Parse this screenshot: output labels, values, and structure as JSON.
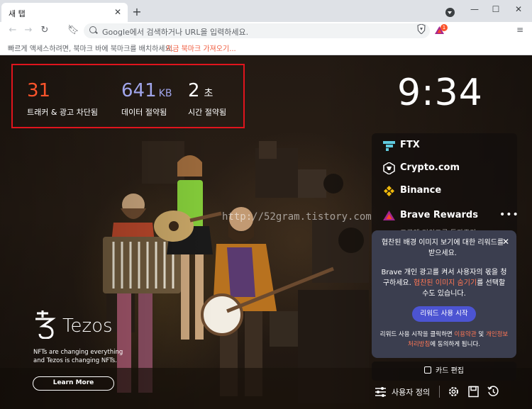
{
  "browser": {
    "tab_title": "새 탭",
    "omnibox_placeholder": "Google에서 검색하거나 URL을 입력하세요.",
    "rewards_badge": "1",
    "bookmark_bar_text": "빠르게 액세스하려면, 북마크 바에 북마크를 배치하세요.",
    "bookmark_bar_link": "지금 북마크 가져오기..."
  },
  "stats": {
    "trackers": {
      "value": "31",
      "label": "트래커 & 광고 차단됨",
      "color": "#fb542b"
    },
    "data": {
      "value": "641",
      "unit": "KB",
      "label": "데이터 절약됨",
      "color": "#a0a5eb"
    },
    "time": {
      "value": "2",
      "unit": "초",
      "label": "시간 절약됨",
      "color": "#ffffff"
    }
  },
  "clock": "9:34",
  "watermark": "http://52gram.tistory.com",
  "sponsor": {
    "name": "Tezos",
    "description": "NFTs are changing everything and Tezos is changing NFTs.",
    "button": "Learn More"
  },
  "widgets": {
    "items": [
      {
        "label": "FTX",
        "icon": "ftx-icon"
      },
      {
        "label": "Crypto.com",
        "icon": "crypto-com-icon"
      },
      {
        "label": "Binance",
        "icon": "binance-icon"
      },
      {
        "label": "Brave Rewards",
        "icon": "bat-icon"
      }
    ],
    "rewards_sub": "드루웨 리워드를 통과증가"
  },
  "rewards_popup": {
    "title": "협찬된 배경 이미지 보기에 대한 리워드를 받으세요.",
    "body_pre": "Brave 개인 광고를 켜서 사용자의 몫을 청구하세요. ",
    "body_link": "협찬된 이미지 숨기기",
    "body_post": "를 선택할 수도 있습니다.",
    "button": "리워드 사용 시작",
    "foot_pre": "리워드 사용 시작을 클릭하면 ",
    "foot_link1": "이용약관",
    "foot_mid": " 및 ",
    "foot_link2": "개인정보처리방침",
    "foot_post": "에 동의하게 됩니다."
  },
  "card_edit": "카드 편집",
  "customize": "사용자 정의",
  "colors": {
    "accent_red": "#fb542b",
    "data_purple": "#a0a5eb",
    "popup_bg": "#3b3e4f",
    "popup_button": "#4c54d2",
    "highlight_frame": "#e0141d"
  }
}
